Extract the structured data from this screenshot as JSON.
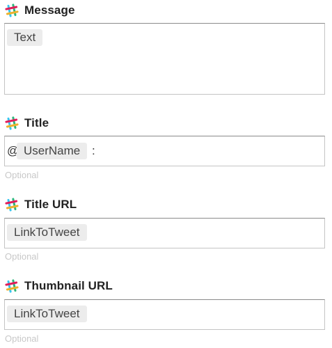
{
  "fields": {
    "message": {
      "label": "Message",
      "token": "Text"
    },
    "title": {
      "label": "Title",
      "prefix": "@",
      "token": "UserName",
      "suffix": ":",
      "hint": "Optional"
    },
    "title_url": {
      "label": "Title URL",
      "token": "LinkToTweet",
      "hint": "Optional"
    },
    "thumbnail_url": {
      "label": "Thumbnail URL",
      "token": "LinkToTweet",
      "hint": "Optional"
    }
  },
  "icon": "slack-icon",
  "colors": {
    "slack_blue": "#36c5f0",
    "slack_green": "#2eb67d",
    "slack_red": "#e01e5a",
    "slack_yellow": "#ecb22e",
    "token_bg": "#ececec",
    "hint_text": "#c8c8c8"
  }
}
